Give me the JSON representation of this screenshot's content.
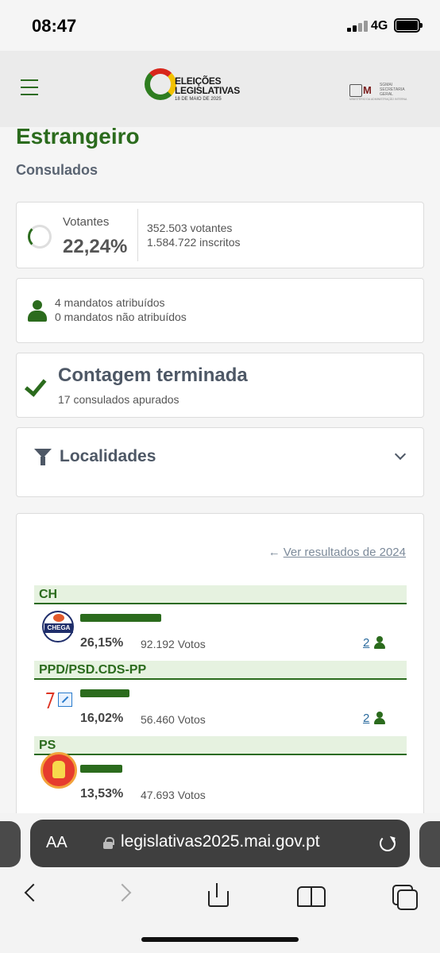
{
  "status_bar": {
    "time": "08:47",
    "network": "4G"
  },
  "header": {
    "logo_line1": "ELEIÇÕES",
    "logo_line2": "LEGISLATIVAS",
    "logo_date": "18 DE MAIO DE 2025",
    "gov_logo_text": "SGMAI SECRETARIA GERAL",
    "gov_logo_sub": "MINISTÉRIO DA ADMINISTRAÇÃO INTERNA"
  },
  "page": {
    "title": "Estrangeiro",
    "subtitle": "Consulados"
  },
  "votantes": {
    "label": "Votantes",
    "percent": "22,24%",
    "voters": "352.503 votantes",
    "registered": "1.584.722 inscritos"
  },
  "mandatos": {
    "assigned": "4 mandatos atribuídos",
    "unassigned": "0 mandatos não atribuídos"
  },
  "contagem": {
    "title": "Contagem terminada",
    "detail": "17 consulados apurados"
  },
  "localidades": {
    "label": "Localidades"
  },
  "results": {
    "previous_link": "Ver resultados de 2024",
    "parties": [
      {
        "name": "CH",
        "percent": "26,15%",
        "votes": "92.192 Votos",
        "seats": "2",
        "share": 26.15,
        "logo_text": "CHEGA"
      },
      {
        "name": "PPD/PSD.CDS-PP",
        "percent": "16,02%",
        "votes": "56.460 Votos",
        "seats": "2",
        "share": 16.02
      },
      {
        "name": "PS",
        "percent": "13,53%",
        "votes": "47.693 Votos",
        "seats": "",
        "share": 13.53
      }
    ]
  },
  "browser": {
    "aa": "AA",
    "url": "legislativas2025.mai.gov.pt"
  },
  "colors": {
    "primary_green": "#2b6b1d",
    "party_header_bg": "#e6f2e0",
    "text_gray": "#4e5866"
  }
}
